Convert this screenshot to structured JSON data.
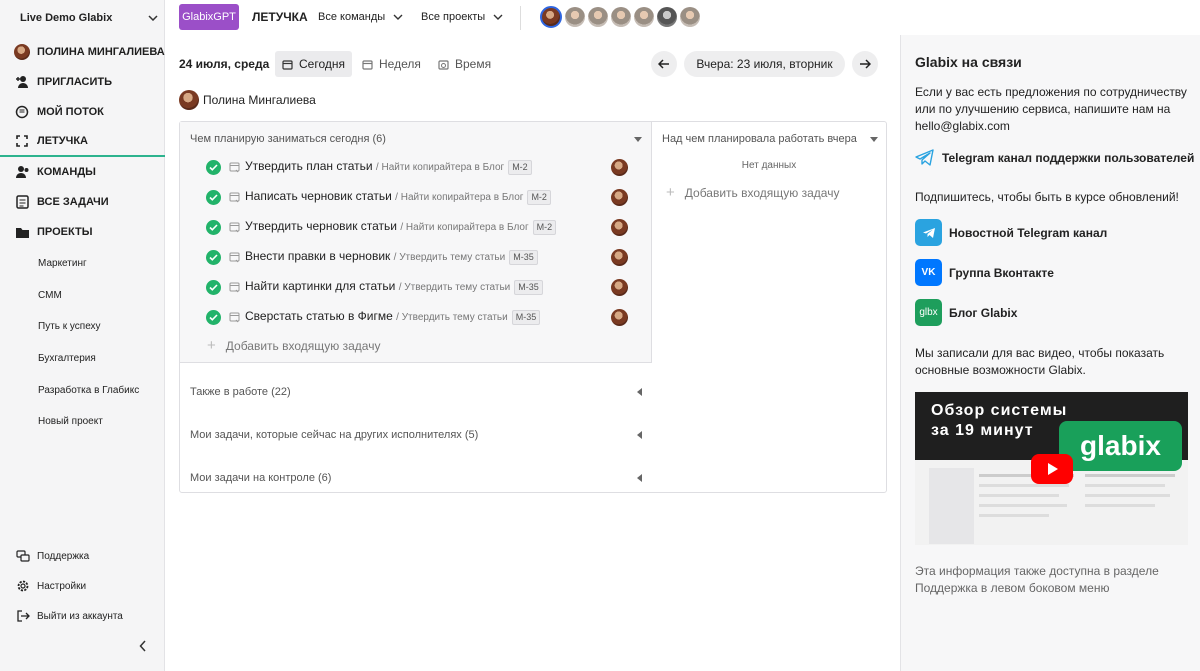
{
  "sidebar": {
    "workspace": "Live Demo Glabix",
    "user_name": "ПОЛИНА МИНГАЛИЕВА",
    "nav": {
      "invite": "ПРИГЛАСИТЬ",
      "stream": "МОЙ ПОТОК",
      "standup": "ЛЕТУЧКА",
      "teams": "КОМАНДЫ",
      "all_tasks": "ВСЕ ЗАДАЧИ",
      "projects": "ПРОЕКТЫ"
    },
    "projects": [
      "Маркетинг",
      "СММ",
      "Путь к успеху",
      "Бухгалтерия",
      "Разработка в Глабикс",
      "Новый проект"
    ],
    "bottom": {
      "support": "Поддержка",
      "settings": "Настройки",
      "logout": "Выйти из аккаунта"
    }
  },
  "topbar": {
    "gpt_button": "GlabixGPT",
    "title": "ЛЕТУЧКА",
    "teams_filter": "Все команды",
    "projects_filter": "Все проекты"
  },
  "toolbar": {
    "date": "24 июля, среда",
    "today": "Сегодня",
    "week": "Неделя",
    "time": "Время",
    "yesterday": "Вчера: 23 июля, вторник"
  },
  "user": {
    "name": "Полина Мингалиева"
  },
  "today_column": {
    "header": "Чем планирую заниматься сегодня (6)",
    "tasks": [
      {
        "title": "Утвердить план статьи",
        "parent": "/ Найти копирайтера в Блог",
        "code": "М-2"
      },
      {
        "title": "Написать черновик статьи",
        "parent": "/ Найти копирайтера в Блог",
        "code": "М-2"
      },
      {
        "title": "Утвердить черновик статьи",
        "parent": "/ Найти копирайтера в Блог",
        "code": "М-2"
      },
      {
        "title": "Внести правки в черновик",
        "parent": "/ Утвердить тему статьи",
        "code": "М-35"
      },
      {
        "title": "Найти картинки для статьи",
        "parent": "/ Утвердить тему статьи",
        "code": "М-35"
      },
      {
        "title": "Сверстать статью в Фигме",
        "parent": "/ Утвердить тему статьи",
        "code": "М-35"
      }
    ],
    "add_task": "Добавить входящую задачу",
    "sections": [
      "Также в работе (22)",
      "Мои задачи, которые сейчас на других исполнителях (5)",
      "Мои задачи на контроле (6)"
    ]
  },
  "yesterday_column": {
    "header": "Над чем планировала работать вчера",
    "empty": "Нет данных",
    "add_task": "Добавить входящую задачу"
  },
  "panel": {
    "title": "Glabix на связи",
    "intro": "Если у вас есть предложения по сотрудничеству или по улучшению сервиса, напишите нам на",
    "email": "hello@glabix.com",
    "telegram_support": "Telegram канал поддержки пользователей",
    "subscribe": "Подпишитесь, чтобы быть в курсе обновлений!",
    "links": [
      "Новостной Telegram канал",
      "Группа Вконтакте",
      "Блог Glabix"
    ],
    "video_intro": "Мы записали для вас видео, чтобы показать основные возможности Glabix.",
    "video_title": "Обзор системы за 19 минут",
    "video_logo": "glabix",
    "vk_logo": "VK",
    "blog_logo": "glbx",
    "note": "Эта информация также доступна в разделе Поддержка в левом боковом меню",
    "colors": {
      "telegram": "#2aa3e0",
      "vk": "#0077ff",
      "blog": "#1e9e5c"
    }
  }
}
